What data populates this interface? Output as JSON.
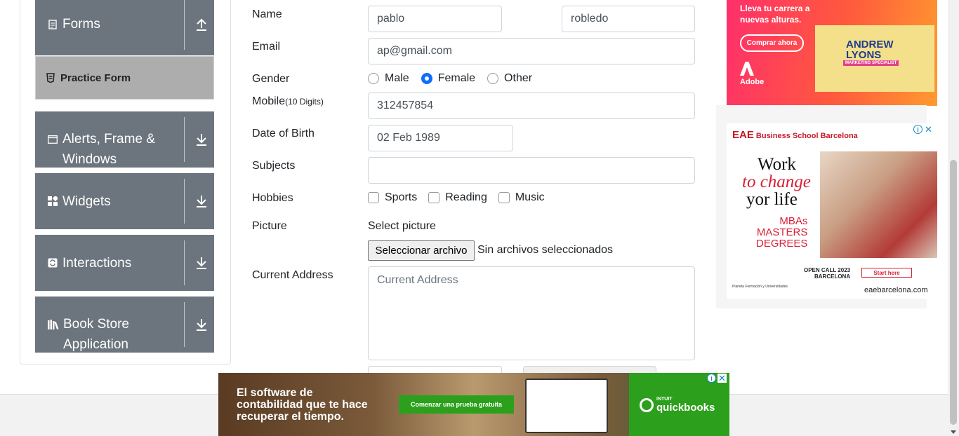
{
  "sidebar": {
    "groups": [
      {
        "id": "forms",
        "title": "Forms",
        "icon": "document-icon",
        "arrow": "collapse"
      },
      {
        "id": "alerts",
        "title": "Alerts, Frame & Windows",
        "icon": "window-icon",
        "arrow": "expand"
      },
      {
        "id": "widgets",
        "title": "Widgets",
        "icon": "widgets-icon",
        "arrow": "expand"
      },
      {
        "id": "interactions",
        "title": "Interactions",
        "icon": "interactions-icon",
        "arrow": "expand"
      },
      {
        "id": "bookstore",
        "title": "Book Store Application",
        "icon": "books-icon",
        "arrow": "expand"
      }
    ],
    "active_item": "Practice Form"
  },
  "form": {
    "name_label": "Name",
    "first_name": "pablo",
    "last_name": "robledo",
    "email_label": "Email",
    "email": "ap@gmail.com",
    "gender_label": "Gender",
    "gender_options": [
      "Male",
      "Female",
      "Other"
    ],
    "gender_selected": "Female",
    "mobile_label": "Mobile",
    "mobile_hint": "(10 Digits)",
    "mobile": "312457854",
    "dob_label": "Date of Birth",
    "dob": "02 Feb 1989",
    "subjects_label": "Subjects",
    "subjects": "",
    "hobbies_label": "Hobbies",
    "hobbies": [
      "Sports",
      "Reading",
      "Music"
    ],
    "picture_label": "Picture",
    "select_picture": "Select picture",
    "file_button": "Seleccionar archivo",
    "file_status": "Sin archivos seleccionados",
    "address_label": "Current Address",
    "address_placeholder": "Current Address"
  },
  "ads": {
    "adobe": {
      "headline_1": "Lleva tu carrera a",
      "headline_2": "nuevas alturas.",
      "cta": "Comprar ahora",
      "brand": "Adobe",
      "card_name_1": "ANDREW",
      "card_name_2": "LYONS",
      "card_role": "MARKETING SPECIALIST"
    },
    "eae": {
      "brand": "EAE",
      "brand_sub": "Business School Barcelona",
      "line1": "Work",
      "line2": "to change",
      "line3": "yor life",
      "deg1": "MBAs",
      "deg2": "MASTERS",
      "deg3": "DEGREES",
      "open1": "OPEN CALL 2023",
      "open2": "BARCELONA",
      "start": "Start here",
      "url": "eaebarcelona.com",
      "partner": "Planeta Formación y Universidades"
    },
    "quickbooks": {
      "line1": "El software de",
      "line2": "contabilidad que te hace",
      "line3": "recuperar el tiempo.",
      "cta": "Comenzar una prueba gratuita",
      "intuit": "INTUIT",
      "brand": "quickbooks"
    }
  }
}
